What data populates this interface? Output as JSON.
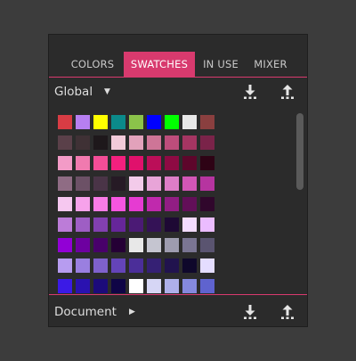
{
  "tabs": [
    {
      "label": "COLORS"
    },
    {
      "label": "SWATCHES"
    },
    {
      "label": "IN USE"
    },
    {
      "label": "MIXER"
    }
  ],
  "global_row": {
    "label": "Global",
    "caret": "▼",
    "download_icon": "download-icon",
    "upload_icon": "upload-icon"
  },
  "document_row": {
    "label": "Document",
    "caret": "▶",
    "download_icon": "download-icon",
    "upload_icon": "upload-icon"
  },
  "accent_color": "#d83a6e",
  "swatches": [
    [
      "#d83c44",
      "#b77ff1",
      "#ffff00",
      "#0b8a8a",
      "#8bc34a",
      "#0000ff",
      "#00ff00",
      "#e8e8e8",
      "#8a3f3f",
      "#e3e3e3",
      "#bfa4b2",
      "#a0879a",
      "#7c5766"
    ],
    [
      "#5a4049",
      "#3f3135",
      "#1e181b",
      "#f2cad9",
      "#e2a2bb",
      "#ce7597",
      "#bd4d7b",
      "#a53562",
      "#7a2349",
      "#5a1a34",
      "#2e0c19",
      "#ffcfe6",
      "#e8e8e8"
    ],
    [
      "#f39bc7",
      "#f07aaf",
      "#f34d97",
      "#f3207e",
      "#e0116c",
      "#bb0e58",
      "#8e0a43",
      "#5d062b",
      "#2e0315",
      "#ffffff",
      "#d8c7cf",
      "#ad94a2",
      "#806773"
    ],
    [
      "#8f6c84",
      "#6c5166",
      "#4a3447",
      "#261a25",
      "#f3cbea",
      "#e8a4d8",
      "#dd7dc7",
      "#d156b6",
      "#b634a0",
      "#93287f",
      "#6c1c5e",
      "#471240",
      "#23091f"
    ],
    [
      "#f6c8f0",
      "#f7a2eb",
      "#f87ce6",
      "#f656e0",
      "#e63bd2",
      "#c029ad",
      "#911d83",
      "#620f58",
      "#30072c",
      "#ffffff",
      "#e3cdf0",
      "#c9a4e3",
      "#a57bd2"
    ],
    [
      "#bc7cd8",
      "#9e5ec4",
      "#8240b0",
      "#66269a",
      "#4b1a75",
      "#341256",
      "#1e0934",
      "#f3dcff",
      "#ebbcff",
      "#e395ff",
      "#db6cff",
      "#d53bff",
      "#c800ff"
    ],
    [
      "#9200d6",
      "#6d00a0",
      "#48006a",
      "#250035",
      "#e8e8e8",
      "#c5c5d0",
      "#9e9caf",
      "#7a7592",
      "#5a5470",
      "#3a3650",
      "#1c1a28",
      "#e6e6ff",
      "#c8c8ff"
    ],
    [
      "#b79cf0",
      "#9a7fe0",
      "#7f61cc",
      "#6444b8",
      "#4b2e99",
      "#352074",
      "#21134e",
      "#0f082b",
      "#e4ddff",
      "#c3b6ff",
      "#9c8aff",
      "#7356ff",
      "#5022ff"
    ],
    [
      "#3b1ae6",
      "#2a12b0",
      "#1c0b7a",
      "#0f0546",
      "#ffffff",
      "#d6d6f5",
      "#aeb0ea",
      "#8589de",
      "#5f63cf",
      "#3d42b5",
      "#262c8e",
      "#151a60",
      "#0a0d33"
    ]
  ]
}
